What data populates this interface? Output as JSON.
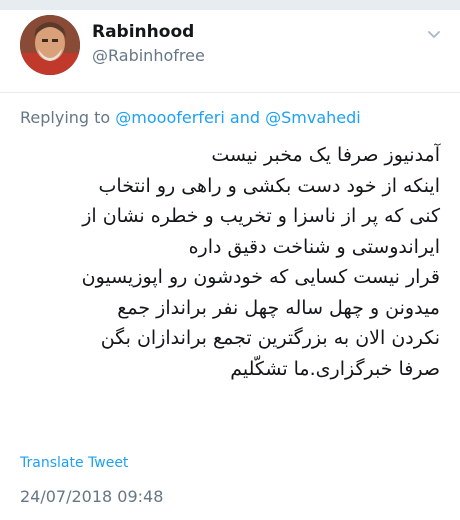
{
  "user": {
    "display_name": "Rabinhood",
    "handle": "@Rabinhofree"
  },
  "icons": {
    "menu": "chevron-down-icon"
  },
  "reply": {
    "prefix": "Replying to",
    "mention_1": "@moooferferi",
    "connector": "and",
    "mention_2": "@Smvahedi"
  },
  "tweet": {
    "lines": [
      "آمدنیوز صرفا یک مخبر نیست",
      "اینکه از خود دست بکشی و راهی رو انتخاب",
      "کنی که پر از ناسزا و تخریب و خطره نشان از",
      "ایراندوستی و شناخت دقیق داره",
      "قرار نیست کسایی که خودشون رو اپوزیسیون",
      "میدونن و چهل ساله چهل نفر برانداز جمع",
      "نکردن الان به بزرگترین تجمع براندازان بگن",
      "صرفا خبرگزاری.ما تشکّلیم"
    ]
  },
  "translate_label": "Translate Tweet",
  "timestamp": "24/07/2018 09:48",
  "colors": {
    "link": "#1da1f2",
    "secondary_text": "#657786",
    "primary_text": "#14171a",
    "divider": "#e6ecf0"
  }
}
